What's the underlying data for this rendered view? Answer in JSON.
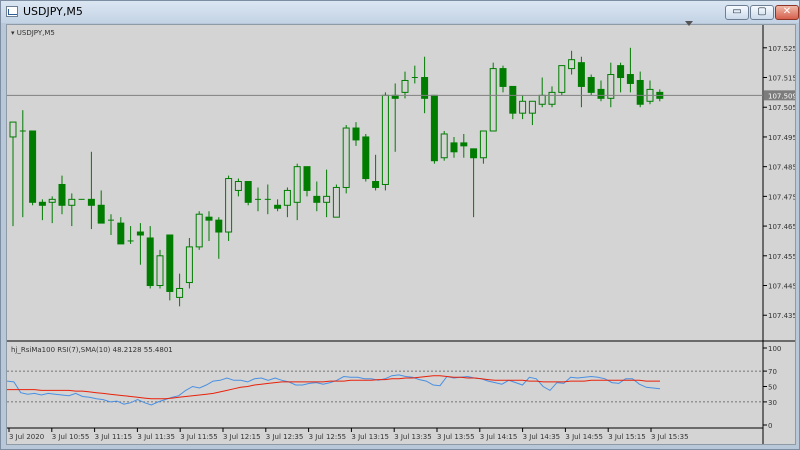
{
  "window": {
    "title": "USDJPY,M5",
    "buttons": {
      "minimize": "▭",
      "maximize": "▢",
      "close": "✕"
    }
  },
  "chart_data": [
    {
      "type": "candlestick",
      "title": "USDJPY,M5",
      "symbol_label": "USDJPY,M5",
      "ylim": [
        107.427,
        107.532
      ],
      "y_ticks": [
        "107.525",
        "107.515",
        "107.505",
        "107.495",
        "107.485",
        "107.475",
        "107.465",
        "107.455",
        "107.445",
        "107.435"
      ],
      "current_price": "107.509",
      "colors": {
        "up_body": "#d4d4d4",
        "down_body": "#007c00",
        "wick": "#007c00",
        "price_line": "#808080",
        "price_tag_bg": "#7c7c7c"
      },
      "candles": [
        {
          "o": 107.495,
          "h": 107.5,
          "l": 107.465,
          "c": 107.5
        },
        {
          "o": 107.497,
          "h": 107.504,
          "l": 107.468,
          "c": 107.497
        },
        {
          "o": 107.497,
          "h": 107.497,
          "l": 107.472,
          "c": 107.473
        },
        {
          "o": 107.473,
          "h": 107.474,
          "l": 107.467,
          "c": 107.472
        },
        {
          "o": 107.473,
          "h": 107.475,
          "l": 107.466,
          "c": 107.474
        },
        {
          "o": 107.479,
          "h": 107.482,
          "l": 107.469,
          "c": 107.472
        },
        {
          "o": 107.472,
          "h": 107.476,
          "l": 107.465,
          "c": 107.474
        },
        {
          "o": 107.474,
          "h": 107.474,
          "l": 107.474,
          "c": 107.474
        },
        {
          "o": 107.474,
          "h": 107.49,
          "l": 107.464,
          "c": 107.472
        },
        {
          "o": 107.472,
          "h": 107.477,
          "l": 107.466,
          "c": 107.466
        },
        {
          "o": 107.467,
          "h": 107.469,
          "l": 107.462,
          "c": 107.467
        },
        {
          "o": 107.466,
          "h": 107.468,
          "l": 107.46,
          "c": 107.459
        },
        {
          "o": 107.46,
          "h": 107.465,
          "l": 107.459,
          "c": 107.46
        },
        {
          "o": 107.463,
          "h": 107.466,
          "l": 107.452,
          "c": 107.462
        },
        {
          "o": 107.461,
          "h": 107.465,
          "l": 107.444,
          "c": 107.445
        },
        {
          "o": 107.445,
          "h": 107.457,
          "l": 107.444,
          "c": 107.455
        },
        {
          "o": 107.462,
          "h": 107.462,
          "l": 107.44,
          "c": 107.443
        },
        {
          "o": 107.441,
          "h": 107.449,
          "l": 107.438,
          "c": 107.444
        },
        {
          "o": 107.446,
          "h": 107.461,
          "l": 107.444,
          "c": 107.458
        },
        {
          "o": 107.458,
          "h": 107.47,
          "l": 107.457,
          "c": 107.469
        },
        {
          "o": 107.468,
          "h": 107.47,
          "l": 107.46,
          "c": 107.467
        },
        {
          "o": 107.467,
          "h": 107.468,
          "l": 107.454,
          "c": 107.463
        },
        {
          "o": 107.463,
          "h": 107.482,
          "l": 107.46,
          "c": 107.481
        },
        {
          "o": 107.477,
          "h": 107.481,
          "l": 107.475,
          "c": 107.48
        },
        {
          "o": 107.48,
          "h": 107.48,
          "l": 107.472,
          "c": 107.473
        },
        {
          "o": 107.474,
          "h": 107.478,
          "l": 107.47,
          "c": 107.474
        },
        {
          "o": 107.474,
          "h": 107.479,
          "l": 107.469,
          "c": 107.474
        },
        {
          "o": 107.472,
          "h": 107.474,
          "l": 107.47,
          "c": 107.471
        },
        {
          "o": 107.472,
          "h": 107.478,
          "l": 107.468,
          "c": 107.477
        },
        {
          "o": 107.473,
          "h": 107.486,
          "l": 107.467,
          "c": 107.485
        },
        {
          "o": 107.485,
          "h": 107.485,
          "l": 107.475,
          "c": 107.477
        },
        {
          "o": 107.475,
          "h": 107.48,
          "l": 107.47,
          "c": 107.473
        },
        {
          "o": 107.473,
          "h": 107.484,
          "l": 107.468,
          "c": 107.475
        },
        {
          "o": 107.468,
          "h": 107.479,
          "l": 107.468,
          "c": 107.478
        },
        {
          "o": 107.478,
          "h": 107.499,
          "l": 107.476,
          "c": 107.498
        },
        {
          "o": 107.498,
          "h": 107.5,
          "l": 107.492,
          "c": 107.494
        },
        {
          "o": 107.495,
          "h": 107.496,
          "l": 107.48,
          "c": 107.481
        },
        {
          "o": 107.48,
          "h": 107.489,
          "l": 107.477,
          "c": 107.478
        },
        {
          "o": 107.479,
          "h": 107.51,
          "l": 107.477,
          "c": 107.509
        },
        {
          "o": 107.509,
          "h": 107.513,
          "l": 107.49,
          "c": 107.508
        },
        {
          "o": 107.51,
          "h": 107.517,
          "l": 107.508,
          "c": 107.514
        },
        {
          "o": 107.515,
          "h": 107.519,
          "l": 107.513,
          "c": 107.515
        },
        {
          "o": 107.515,
          "h": 107.522,
          "l": 107.503,
          "c": 107.508
        },
        {
          "o": 107.509,
          "h": 107.509,
          "l": 107.486,
          "c": 107.487
        },
        {
          "o": 107.488,
          "h": 107.497,
          "l": 107.487,
          "c": 107.496
        },
        {
          "o": 107.493,
          "h": 107.495,
          "l": 107.488,
          "c": 107.49
        },
        {
          "o": 107.493,
          "h": 107.496,
          "l": 107.488,
          "c": 107.492
        },
        {
          "o": 107.491,
          "h": 107.491,
          "l": 107.468,
          "c": 107.488
        },
        {
          "o": 107.488,
          "h": 107.497,
          "l": 107.486,
          "c": 107.497
        },
        {
          "o": 107.497,
          "h": 107.52,
          "l": 107.497,
          "c": 107.518
        },
        {
          "o": 107.518,
          "h": 107.519,
          "l": 107.51,
          "c": 107.512
        },
        {
          "o": 107.512,
          "h": 107.512,
          "l": 107.501,
          "c": 107.503
        },
        {
          "o": 107.503,
          "h": 107.509,
          "l": 107.501,
          "c": 107.507
        },
        {
          "o": 107.503,
          "h": 107.507,
          "l": 107.499,
          "c": 107.507
        },
        {
          "o": 107.506,
          "h": 107.515,
          "l": 107.505,
          "c": 107.509
        },
        {
          "o": 107.506,
          "h": 107.512,
          "l": 107.505,
          "c": 107.51
        },
        {
          "o": 107.51,
          "h": 107.519,
          "l": 107.509,
          "c": 107.519
        },
        {
          "o": 107.518,
          "h": 107.524,
          "l": 107.516,
          "c": 107.521
        },
        {
          "o": 107.52,
          "h": 107.522,
          "l": 107.505,
          "c": 107.512
        },
        {
          "o": 107.515,
          "h": 107.516,
          "l": 107.509,
          "c": 107.51
        },
        {
          "o": 107.511,
          "h": 107.514,
          "l": 107.507,
          "c": 107.508
        },
        {
          "o": 107.508,
          "h": 107.52,
          "l": 107.505,
          "c": 107.516
        },
        {
          "o": 107.519,
          "h": 107.52,
          "l": 107.51,
          "c": 107.515
        },
        {
          "o": 107.516,
          "h": 107.525,
          "l": 107.51,
          "c": 107.513
        },
        {
          "o": 107.514,
          "h": 107.517,
          "l": 107.505,
          "c": 107.506
        },
        {
          "o": 107.507,
          "h": 107.514,
          "l": 107.506,
          "c": 107.511
        },
        {
          "o": 107.51,
          "h": 107.511,
          "l": 107.507,
          "c": 107.508
        }
      ]
    },
    {
      "type": "line",
      "title": "hj_RsiMa100 RSI(7),SMA(10) 48.2128 55.4801",
      "ylim": [
        0,
        100
      ],
      "y_ticks": [
        "100",
        "70",
        "50",
        "30",
        "0"
      ],
      "levels": [
        70,
        30
      ],
      "series": [
        {
          "color": "#4a90e2",
          "values": [
            57,
            56,
            42,
            40,
            41,
            39,
            41,
            40,
            39,
            38,
            41,
            37,
            36,
            34,
            33,
            30,
            31,
            27,
            29,
            33,
            29,
            26,
            30,
            33,
            36,
            38,
            45,
            50,
            48,
            52,
            57,
            58,
            61,
            58,
            58,
            56,
            60,
            61,
            58,
            61,
            58,
            56,
            52,
            52,
            54,
            55,
            53,
            55,
            58,
            63,
            62,
            62,
            60,
            60,
            58,
            60,
            64,
            65,
            63,
            62,
            59,
            57,
            52,
            51,
            63,
            61,
            62,
            63,
            61,
            60,
            57,
            55,
            53,
            58,
            55,
            52,
            62,
            60,
            50,
            45,
            55,
            54,
            62,
            61,
            62,
            63,
            62,
            60,
            55,
            54,
            60,
            60,
            53,
            49,
            48,
            47
          ]
        },
        {
          "color": "#e8220b",
          "values": [
            46,
            46,
            46,
            46,
            46,
            45,
            45,
            45,
            45,
            45,
            44,
            44,
            43,
            42,
            41,
            40,
            39,
            38,
            37,
            36,
            35,
            34,
            34,
            34,
            35,
            36,
            37,
            38,
            39,
            40,
            41,
            43,
            45,
            47,
            49,
            50,
            52,
            53,
            54,
            55,
            56,
            56,
            56,
            56,
            56,
            56,
            56,
            57,
            57,
            57,
            58,
            58,
            58,
            58,
            59,
            59,
            60,
            60,
            61,
            61,
            62,
            63,
            64,
            64,
            63,
            62,
            62,
            61,
            61,
            60,
            59,
            58,
            58,
            58,
            58,
            58,
            57,
            57,
            56,
            56,
            56,
            56,
            57,
            57,
            57,
            58,
            58,
            58,
            58,
            58,
            58,
            58,
            58,
            57,
            57,
            57
          ]
        }
      ]
    }
  ],
  "x_axis_labels": [
    "3 Jul 2020",
    "3 Jul 10:55",
    "3 Jul 11:15",
    "3 Jul 11:35",
    "3 Jul 11:55",
    "3 Jul 12:15",
    "3 Jul 12:35",
    "3 Jul 12:55",
    "3 Jul 13:15",
    "3 Jul 13:35",
    "3 Jul 13:55",
    "3 Jul 14:15",
    "3 Jul 14:35",
    "3 Jul 14:55",
    "3 Jul 15:15",
    "3 Jul 15:35"
  ]
}
